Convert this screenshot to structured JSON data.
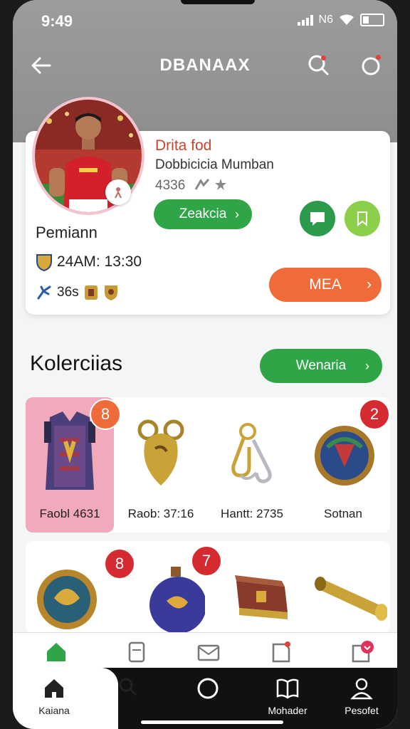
{
  "status": {
    "time": "9:49",
    "network": "Ν6"
  },
  "header": {
    "title": "DBANAAX"
  },
  "profile": {
    "title": "Drita fod",
    "subtitle": "Dobbicicia Mumban",
    "meta": "4336",
    "follow_label": "Zeakcia",
    "name": "Pemiann",
    "time_line": "24AM: 13:30",
    "badges_line": "36s",
    "action_label": "MEA"
  },
  "collection": {
    "title": "Kolerciias",
    "button_label": "Wenaria",
    "row1": [
      {
        "label": "Faobl 4631",
        "badge": "8",
        "icon": "vest-icon"
      },
      {
        "label": "Raob: 37:16",
        "badge": "",
        "icon": "bell-icon"
      },
      {
        "label": "Hantt: 2735",
        "badge": "",
        "icon": "keychain-icon"
      },
      {
        "label": "Sotnan",
        "badge": "2",
        "icon": "shield-icon"
      }
    ],
    "row2": [
      {
        "badge": "8",
        "icon": "medal-icon"
      },
      {
        "badge": "7",
        "icon": "ornament-icon"
      },
      {
        "badge": "",
        "icon": "chest-icon"
      },
      {
        "badge": "",
        "icon": "scroll-icon"
      }
    ]
  },
  "system_nav": {
    "items": [
      {
        "label": "Kaiana",
        "icon": "home-icon"
      },
      {
        "label": "",
        "icon": "search-icon"
      },
      {
        "label": "",
        "icon": "circle-home-icon"
      },
      {
        "label": "Mohader",
        "icon": "book-icon"
      },
      {
        "label": "Pesofet",
        "icon": "profile-icon"
      }
    ]
  },
  "colors": {
    "green": "#2fa548",
    "orange": "#ef6c3a",
    "red_badge": "#d52a2f",
    "header_gray": "#969696"
  }
}
